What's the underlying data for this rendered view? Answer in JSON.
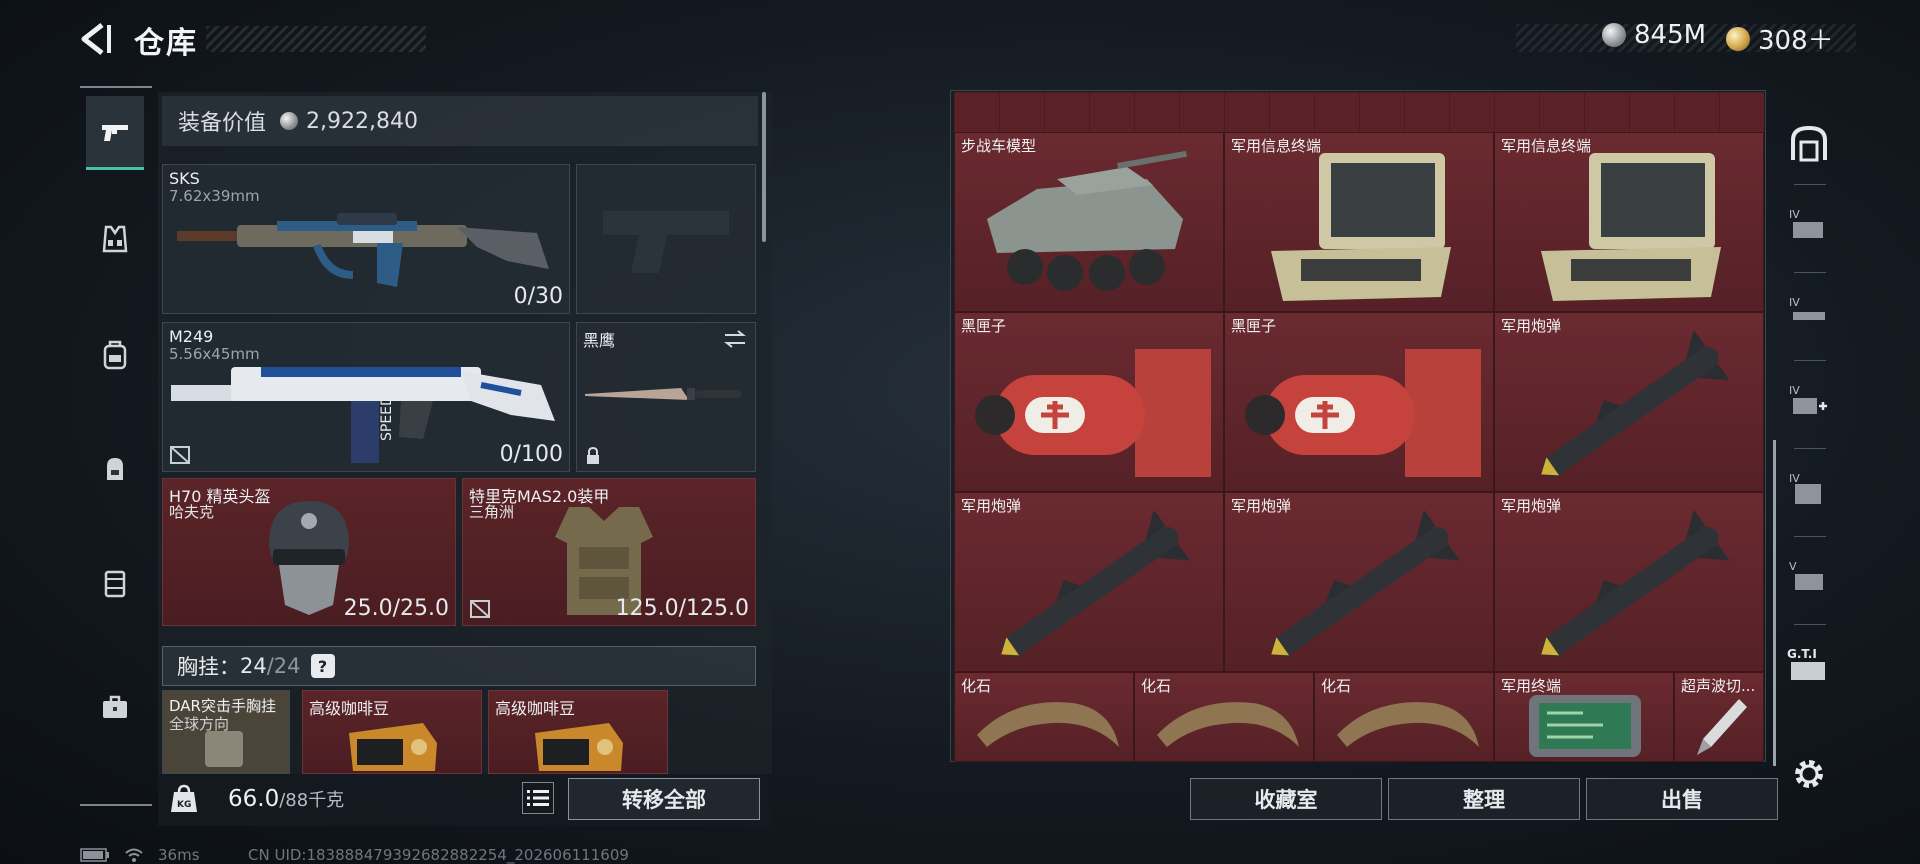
{
  "header": {
    "title": "仓库",
    "currencies": [
      {
        "icon": "silver-coin-icon",
        "value": "845M"
      },
      {
        "icon": "gold-coin-icon",
        "value": "308＋"
      }
    ]
  },
  "left_rail": {
    "items": [
      {
        "name": "weapons",
        "icon": "pistol-icon",
        "active": true
      },
      {
        "name": "vest",
        "icon": "vest-icon",
        "active": false
      },
      {
        "name": "backpack",
        "icon": "backpack-icon",
        "active": false
      },
      {
        "name": "pack",
        "icon": "small-bag-icon",
        "active": false
      },
      {
        "name": "case",
        "icon": "container-icon",
        "active": false
      },
      {
        "name": "toolbox",
        "icon": "toolbox-icon",
        "active": false
      }
    ]
  },
  "equipment": {
    "value_label": "装备价值",
    "value": "2,922,840",
    "primary": {
      "name": "SKS",
      "caliber": "7.62x39mm",
      "ammo": "0/30"
    },
    "secondary": {
      "name": "M249",
      "caliber": "5.56x45mm",
      "ammo": "0/100"
    },
    "melee": {
      "name": "黑鹰"
    },
    "helmet": {
      "name": "H70 精英头盔",
      "brand": "哈夫克",
      "durability": "25.0/25.0"
    },
    "armor": {
      "name": "特里克MAS2.0装甲",
      "brand": "三角洲",
      "durability": "125.0/125.0"
    },
    "chest_rig": {
      "label": "胸挂：",
      "count": "24",
      "max": "/24",
      "help": "?"
    },
    "rig_items": [
      {
        "name": "DAR突击手胸挂",
        "sub": "全球方向"
      },
      {
        "name": "高级咖啡豆"
      },
      {
        "name": "高级咖啡豆"
      }
    ],
    "weight": {
      "current": "66.0",
      "max": "/88",
      "unit": "千克"
    },
    "transfer_all": "转移全部"
  },
  "warehouse": {
    "items": [
      {
        "name": "步战车模型",
        "icon": "apc-model-icon"
      },
      {
        "name": "军用信息终端",
        "icon": "military-terminal-icon"
      },
      {
        "name": "军用信息终端",
        "icon": "military-terminal-icon"
      },
      {
        "name": "黑匣子",
        "icon": "black-box-icon"
      },
      {
        "name": "黑匣子",
        "icon": "black-box-icon"
      },
      {
        "name": "军用炮弹",
        "icon": "missile-icon"
      },
      {
        "name": "军用炮弹",
        "icon": "missile-icon"
      },
      {
        "name": "军用炮弹",
        "icon": "missile-icon"
      },
      {
        "name": "军用炮弹",
        "icon": "missile-icon"
      },
      {
        "name": "化石",
        "icon": "fossil-claw-icon"
      },
      {
        "name": "化石",
        "icon": "fossil-claw-icon"
      },
      {
        "name": "化石",
        "icon": "fossil-claw-icon"
      },
      {
        "name": "军用终端",
        "icon": "circuit-board-icon"
      },
      {
        "name": "超声波切...",
        "icon": "ultrasonic-cutter-icon"
      }
    ],
    "buttons": {
      "collection": "收藏室",
      "sort": "整理",
      "sell": "出售"
    }
  },
  "status_bar": {
    "ping": "36ms",
    "uid": "CN UID:183888479392682882254_202606111609"
  },
  "colors": {
    "accent": "#49c2a4",
    "item_bg": "#5a2227",
    "panel": "#1c232a"
  }
}
